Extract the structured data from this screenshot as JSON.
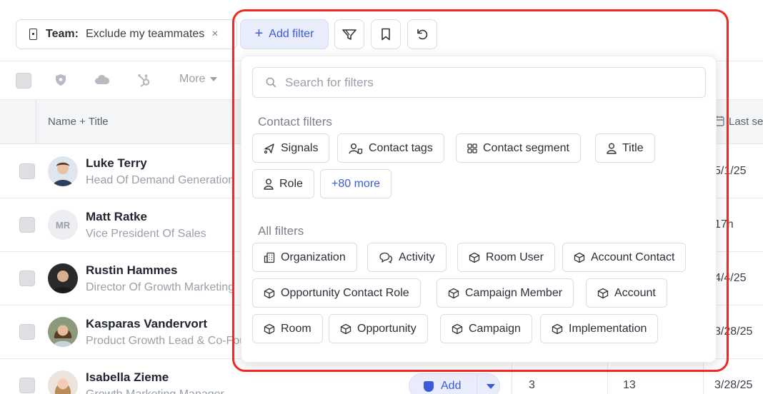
{
  "filter_bar": {
    "team_key": "Team:",
    "team_value": "Exclude my teammates",
    "remove_symbol": "×",
    "add_filter_plus": "+",
    "add_filter_label": "Add filter"
  },
  "toolbar": {
    "more_label": "More"
  },
  "table": {
    "columns": {
      "name_title": "Name + Title",
      "last": "Last se"
    },
    "rows": [
      {
        "name": "Luke Terry",
        "title": "Head Of Demand Generation",
        "last": "5/1/25"
      },
      {
        "name": "Matt Ratke",
        "initials": "MR",
        "title": "Vice President Of Sales",
        "last": "17h"
      },
      {
        "name": "Rustin Hammes",
        "title": "Director Of Growth Marketing",
        "last": "4/4/25"
      },
      {
        "name": "Kasparas Vandervort",
        "title": "Product Growth Lead & Co-Founder",
        "last": "3/28/25"
      },
      {
        "name": "Isabella Zieme",
        "title": "Growth Marketing Manager",
        "last": "3/28/25",
        "add_label": "Add",
        "count_a": "3",
        "count_b": "13"
      }
    ]
  },
  "dropdown": {
    "search_placeholder": "Search for filters",
    "contact_filters_label": "Contact filters",
    "contact_filters": [
      {
        "label": "Signals",
        "icon": "signal-icon"
      },
      {
        "label": "Contact tags",
        "icon": "user-tag-icon"
      },
      {
        "label": "Contact segment",
        "icon": "grid-icon"
      },
      {
        "label": "Title",
        "icon": "person-icon"
      },
      {
        "label": "Role",
        "icon": "person-icon"
      },
      {
        "label": "+80 more",
        "icon": ""
      }
    ],
    "all_filters_label": "All filters",
    "all_filters": [
      {
        "label": "Organization",
        "icon": "building-icon"
      },
      {
        "label": "Activity",
        "icon": "chat-icon"
      },
      {
        "label": "Room User",
        "icon": "box-icon"
      },
      {
        "label": "Account Contact",
        "icon": "box-icon"
      },
      {
        "label": "Opportunity Contact Role",
        "icon": "box-icon"
      },
      {
        "label": "Campaign Member",
        "icon": "box-icon"
      },
      {
        "label": "Account",
        "icon": "box-icon"
      },
      {
        "label": "Room",
        "icon": "box-icon"
      },
      {
        "label": "Opportunity",
        "icon": "box-icon"
      },
      {
        "label": "Campaign",
        "icon": "box-icon"
      },
      {
        "label": "Implementation",
        "icon": "box-icon"
      }
    ]
  },
  "colors": {
    "accent": "#3b5bdb",
    "highlight": "#ee2a24",
    "muted": "#9aa0aa"
  }
}
